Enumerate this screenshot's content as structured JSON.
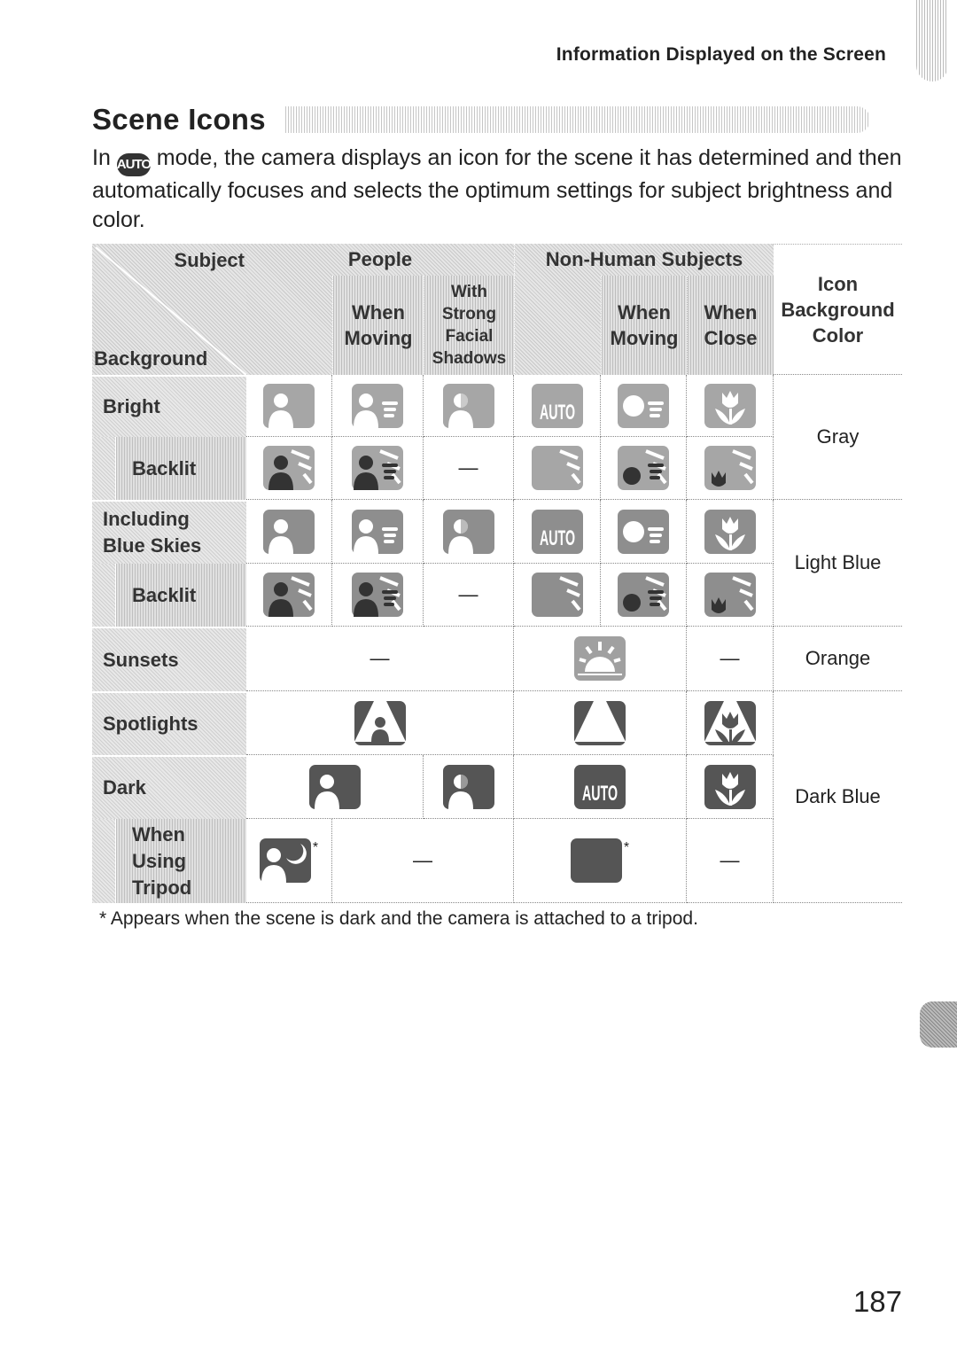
{
  "running_head": "Information Displayed on the Screen",
  "title": "Scene Icons",
  "intro": {
    "before": "In ",
    "mode_badge": "AUTO",
    "after": " mode, the camera displays an icon for the scene it has determined and then automatically focuses and selects the optimum settings for subject brightness and color."
  },
  "table": {
    "corner": {
      "subject": "Subject",
      "background": "Background"
    },
    "groups": {
      "people": "People",
      "non_human": "Non-Human Subjects"
    },
    "subheaders": {
      "people_moving": "When Moving",
      "people_shadows": [
        "With",
        "Strong",
        "Facial",
        "Shadows"
      ],
      "nh_moving": "When Moving",
      "nh_close": "When Close"
    },
    "icon_bg_header": [
      "Icon",
      "Background",
      "Color"
    ],
    "rows": {
      "bright": "Bright",
      "bright_backlit": "Backlit",
      "blue_skies": [
        "Including",
        "Blue Skies"
      ],
      "blue_backlit": "Backlit",
      "sunsets": "Sunsets",
      "spotlights": "Spotlights",
      "dark": "Dark",
      "tripod": [
        "When",
        "Using",
        "Tripod"
      ]
    },
    "colors": {
      "gray": "Gray",
      "light_blue": "Light Blue",
      "orange": "Orange",
      "dark_blue": "Dark Blue"
    },
    "dash": "—",
    "star": "*",
    "auto_icon_text": "AUTO",
    "icon_tones": {
      "gray": "#a6a6a6",
      "light_blue": "#8e8e8e",
      "orange": "#a0a0a0",
      "dark": "#555555"
    }
  },
  "footnote": "*  Appears when the scene is dark and the camera is attached to a tripod.",
  "page_number": "187"
}
